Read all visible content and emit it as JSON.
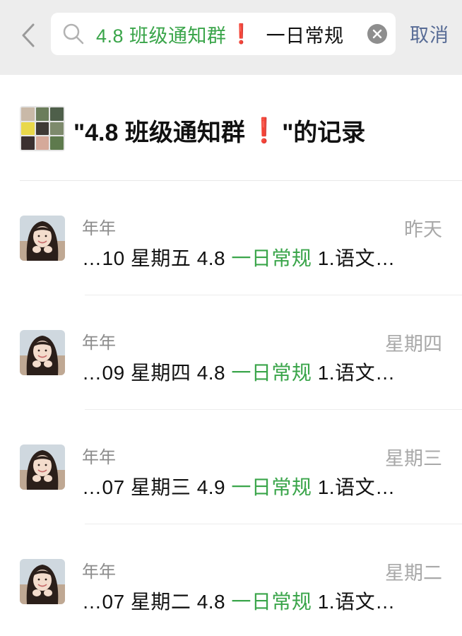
{
  "search": {
    "chip_text": "4.8 班级通知群",
    "chip_mark": "❗",
    "query": "一日常规",
    "cancel_label": "取消"
  },
  "group": {
    "title_prefix": "\"4.8 班级通知群",
    "title_mark": "❗",
    "title_suffix": "\"的记录",
    "avatar_colors": [
      "#c9b9a8",
      "#6b7d5b",
      "#4e5f4a",
      "#e9d84a",
      "#3f3a36",
      "#7d8a6c",
      "#3b3030",
      "#d5a99a",
      "#5e7a4d"
    ]
  },
  "results": [
    {
      "sender": "年年",
      "time": "昨天",
      "before": "…10 星期五 4.8 ",
      "highlight": "一日常规",
      "after": " 1.语文…"
    },
    {
      "sender": "年年",
      "time": "星期四",
      "before": "…09 星期四 4.8 ",
      "highlight": "一日常规",
      "after": " 1.语文…"
    },
    {
      "sender": "年年",
      "time": "星期三",
      "before": "…07 星期三 4.9 ",
      "highlight": "一日常规",
      "after": " 1.语文…"
    },
    {
      "sender": "年年",
      "time": "星期二",
      "before": "…07 星期二 4.8 ",
      "highlight": "一日常规",
      "after": " 1.语文…"
    }
  ],
  "colors": {
    "highlight": "#3aa54a",
    "cancel": "#576b95",
    "mark": "#e3242b",
    "topbar_bg": "#ededed"
  },
  "icons": {
    "back": "chevron-left-icon",
    "search": "search-icon",
    "clear": "clear-icon"
  }
}
